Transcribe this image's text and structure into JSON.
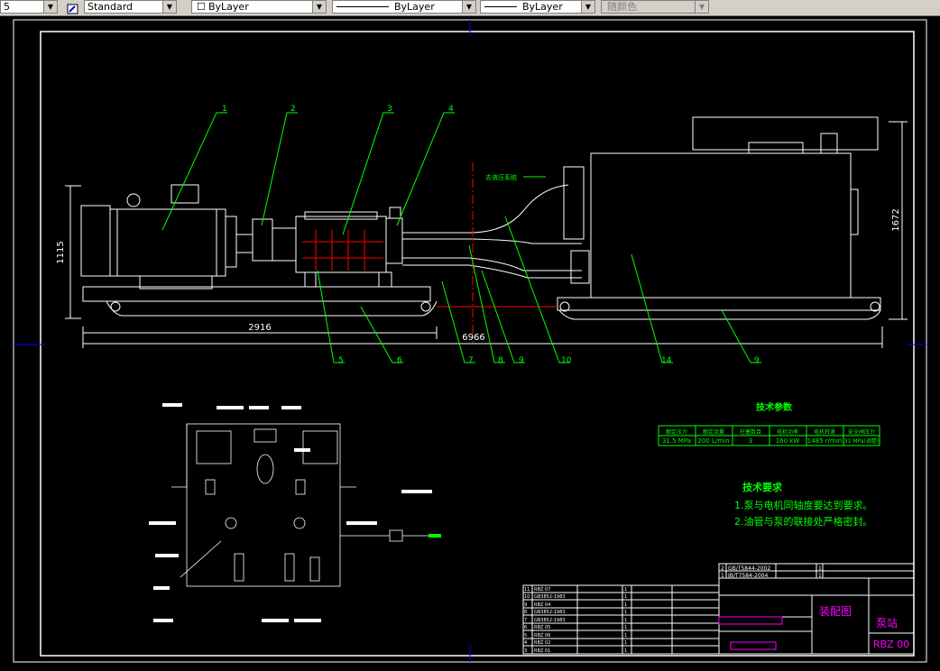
{
  "toolbar": {
    "scale_value": "5",
    "text_style": "Standard",
    "layer": "ByLayer",
    "linetype": "ByLayer",
    "lineweight": "ByLayer",
    "color": "随颜色"
  },
  "dimensions": {
    "width_left": "2916",
    "width_total": "6966",
    "height_left": "1115",
    "height_right": "1672"
  },
  "balloons": [
    "1",
    "2",
    "3",
    "4",
    "5",
    "6",
    "7",
    "8",
    "9",
    "10",
    "14",
    "9"
  ],
  "callout_text": "去液压系统",
  "params": {
    "title": "技术参数",
    "headers": [
      "额定压力",
      "额定流量",
      "柱塞数目",
      "电机功率",
      "电机转速",
      "安全阀压力"
    ],
    "values": [
      "31.5 MPa",
      "200 L/min",
      "3",
      "160 kW",
      "1485 r/min",
      "31 MPa(调整)"
    ]
  },
  "requirements": {
    "title": "技术要求",
    "items": [
      "1.泵与电机同轴度要达到要求。",
      "2.油管与泵的联接处严格密封。"
    ]
  },
  "title_block": {
    "drawing_name": "装配图",
    "product_name": "泵站",
    "code": "RBZ 00"
  },
  "revision_rows": [
    {
      "no": "2",
      "code": "GB/T5844-2002",
      "name": "",
      "qty": "1"
    },
    {
      "no": "1",
      "code": "JB/T7584-2004",
      "name": "",
      "qty": "1"
    }
  ],
  "parts_rows": [
    {
      "no": "11",
      "code": "RBZ 07",
      "qty": "1"
    },
    {
      "no": "10",
      "code": "GB3852-1983",
      "qty": "1"
    },
    {
      "no": "9",
      "code": "RBZ 04",
      "qty": "1"
    },
    {
      "no": "8",
      "code": "GB3852-1983",
      "qty": "1"
    },
    {
      "no": "7",
      "code": "GB3852-1983",
      "qty": "1"
    },
    {
      "no": "6",
      "code": "RBZ 05",
      "qty": "1"
    },
    {
      "no": "5",
      "code": "RBZ 06",
      "qty": "1"
    },
    {
      "no": "4",
      "code": "RBZ 02",
      "qty": "1"
    },
    {
      "no": "3",
      "code": "RBZ 01",
      "qty": "1"
    }
  ],
  "colors": {
    "background": "#000000",
    "geometry": "#ffffff",
    "leader": "#00ff00",
    "dimension": "#ffffff",
    "center": "#ff0000",
    "frame": "#0000ff",
    "accent": "#ff00ff"
  }
}
